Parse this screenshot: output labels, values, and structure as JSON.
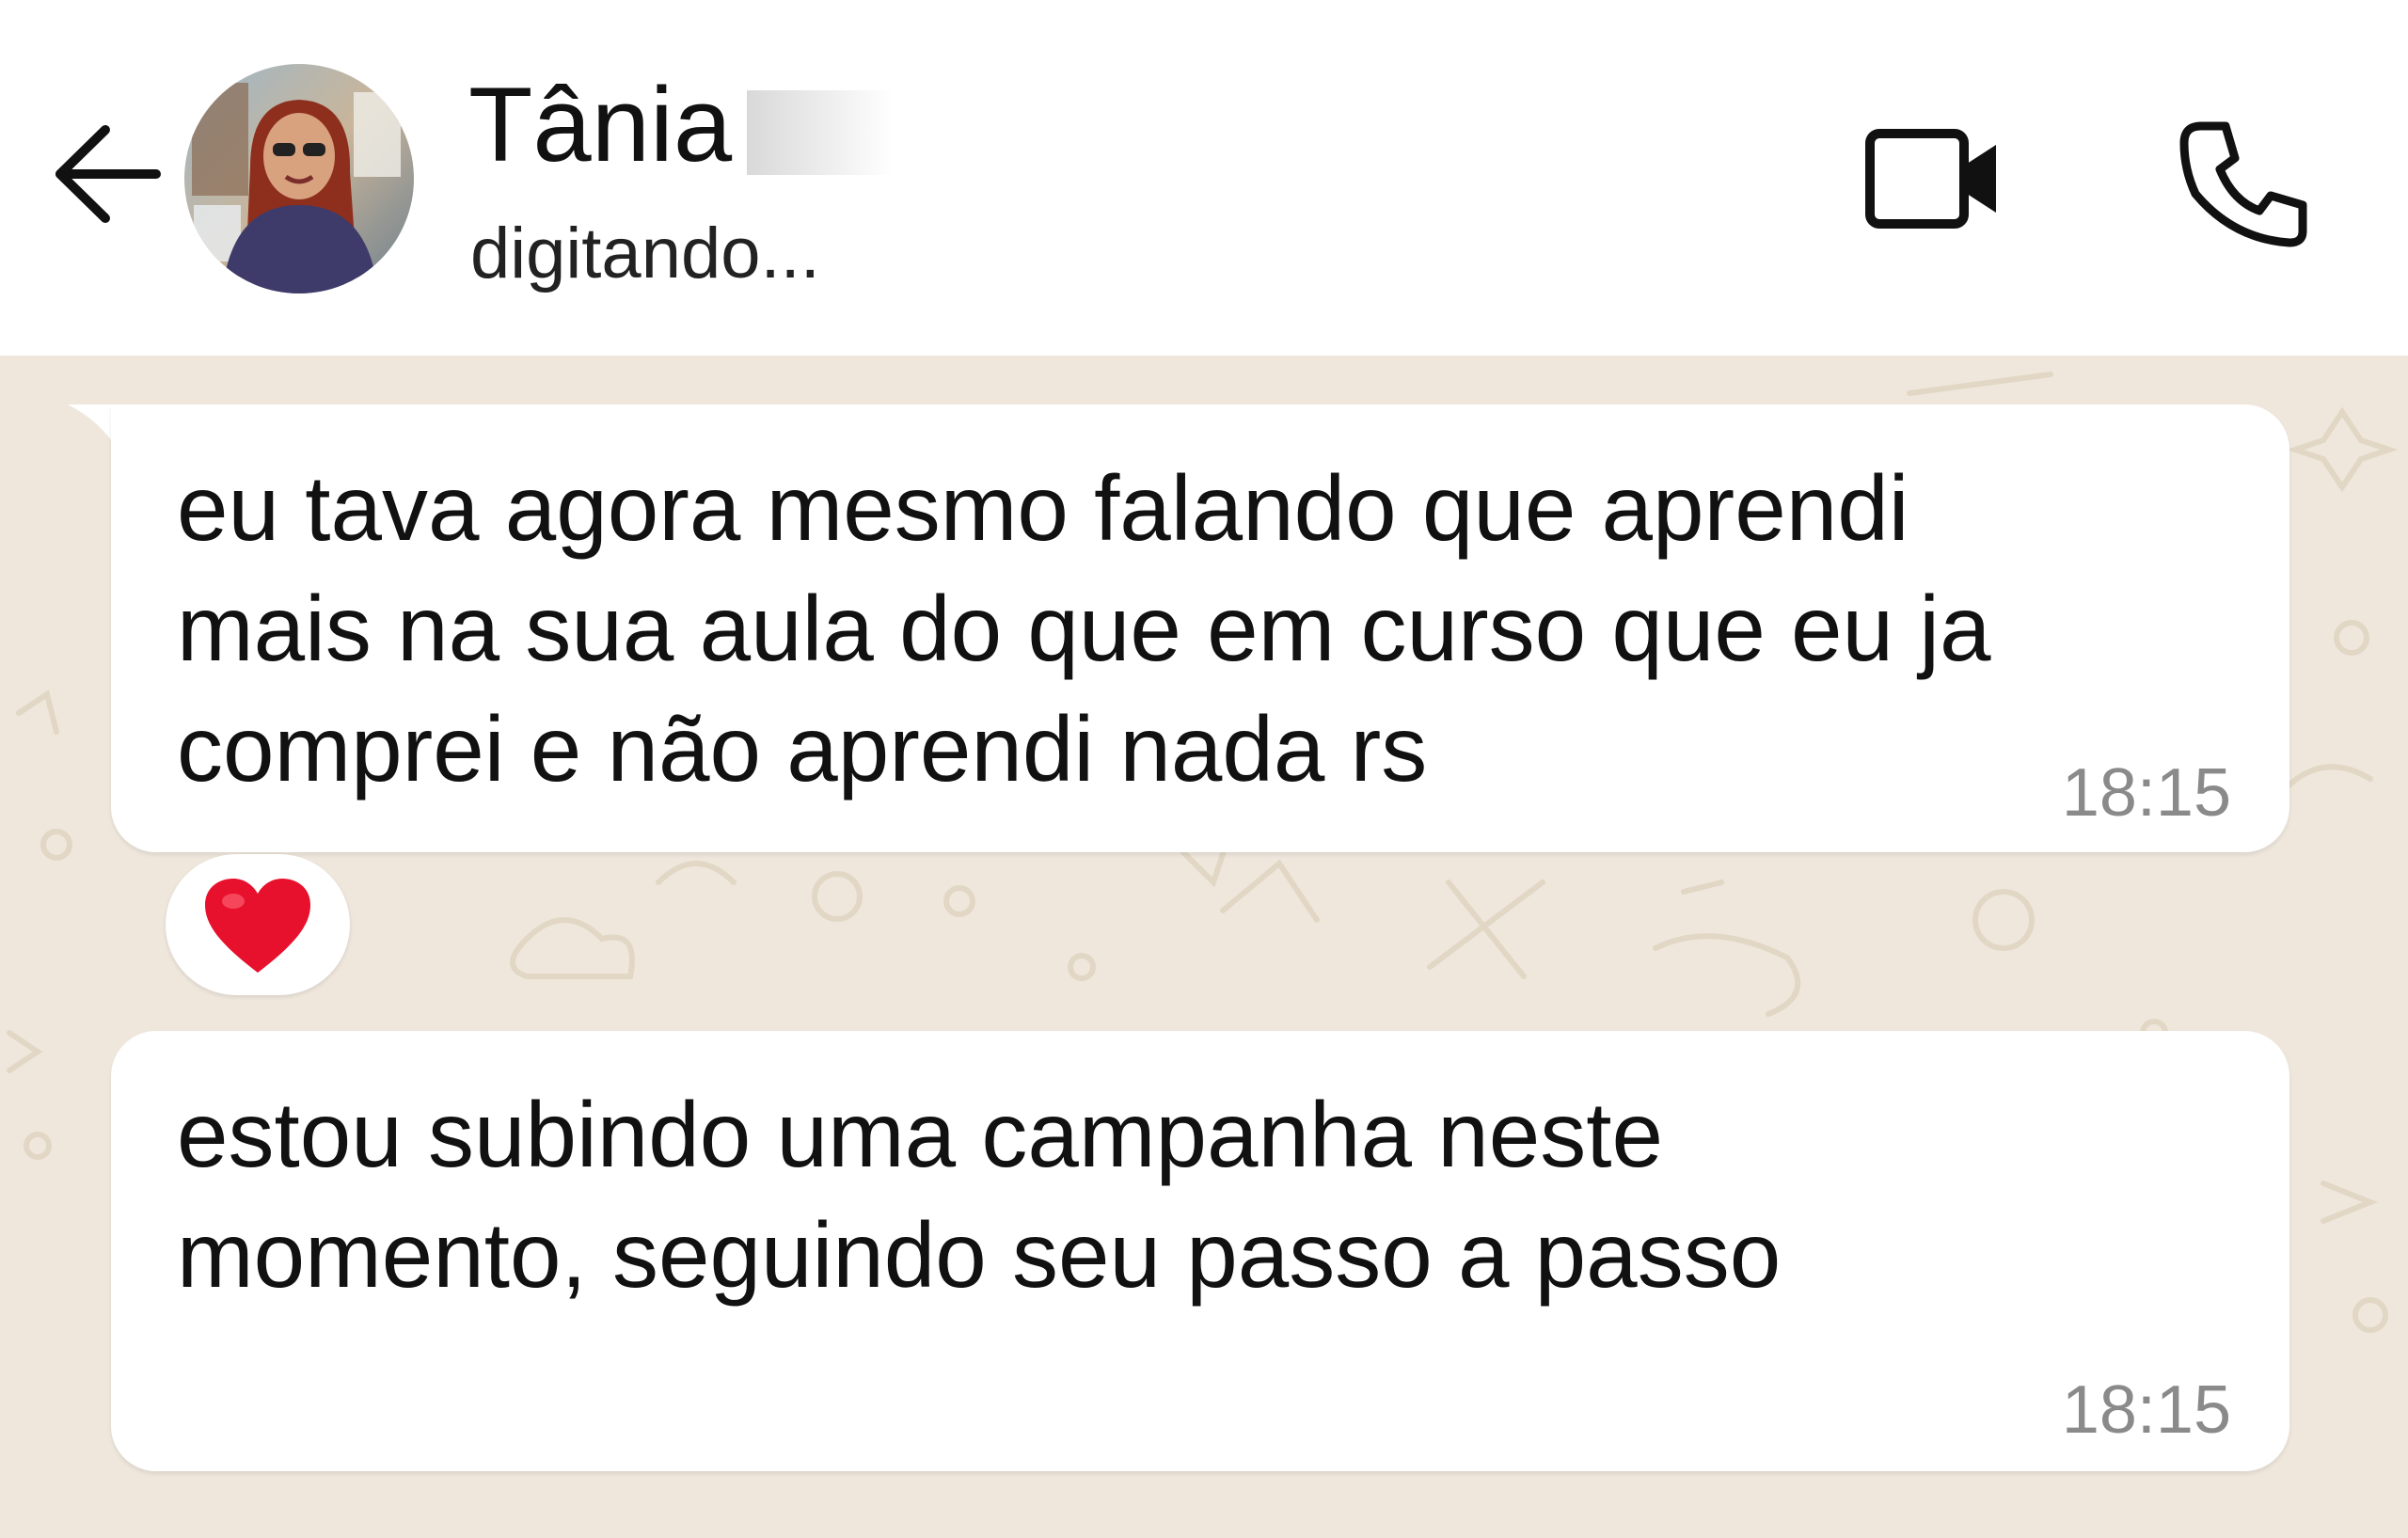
{
  "header": {
    "contact_name": "Tânia",
    "status": "digitando..."
  },
  "messages": [
    {
      "text": "eu tava agora mesmo falando que aprendi\nmais na sua aula do que em curso que eu ja\ncomprei e não aprendi nada rs",
      "time": "18:15",
      "reaction": "heart"
    },
    {
      "text": "estou subindo uma campanha neste\nmomento, seguindo seu passo a passo",
      "time": "18:15"
    }
  ],
  "icons": {
    "back": "arrow-left-icon",
    "video": "video-camera-icon",
    "call": "phone-icon",
    "reaction": "heart-icon"
  },
  "colors": {
    "header_bg": "#ffffff",
    "chat_bg": "#efe7dc",
    "bubble_bg": "#ffffff",
    "time_text": "#8a8a8a",
    "reaction_heart": "#e8112d"
  }
}
